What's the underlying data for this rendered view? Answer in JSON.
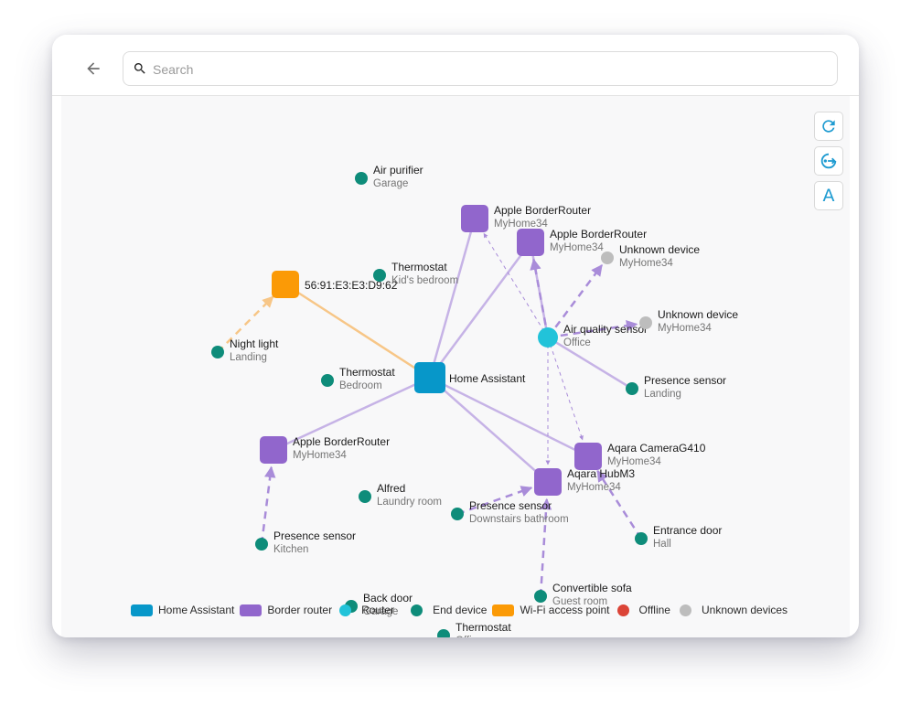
{
  "search": {
    "placeholder": "Search"
  },
  "toolbar": {
    "refresh": "refresh-icon",
    "rotate": "rotate-icon",
    "labels": "A"
  },
  "colors": {
    "home_assistant": "#0797c9",
    "border_router": "#9166cc",
    "router": "#22c3d9",
    "end_device": "#0e8c7a",
    "wifi_ap": "#fb9a06",
    "offline": "#db4437",
    "unknown": "#bdbdbd",
    "edge_solid": "#c6b3e6",
    "edge_dashed": "#a98cd9",
    "edge_wifi": "#f7c687"
  },
  "nodes": [
    {
      "id": "ha",
      "type": "home_assistant",
      "name": "Home Assistant",
      "sub": ""
    },
    {
      "id": "br1",
      "type": "border_router",
      "name": "Apple BorderRouter",
      "sub": "MyHome34"
    },
    {
      "id": "br2",
      "type": "border_router",
      "name": "Apple BorderRouter",
      "sub": "MyHome34"
    },
    {
      "id": "br3",
      "type": "border_router",
      "name": "Apple BorderRouter",
      "sub": "MyHome34"
    },
    {
      "id": "cam",
      "type": "border_router",
      "name": "Aqara CameraG410",
      "sub": "MyHome34"
    },
    {
      "id": "hub",
      "type": "border_router",
      "name": "Aqara HubM3",
      "sub": "MyHome34"
    },
    {
      "id": "wifi",
      "type": "wifi_ap",
      "name": "56:91:E3:E3:D9:62",
      "sub": ""
    },
    {
      "id": "aqs",
      "type": "router",
      "name": "Air quality sensor",
      "sub": "Office"
    },
    {
      "id": "airp",
      "type": "end_device",
      "name": "Air purifier",
      "sub": "Garage"
    },
    {
      "id": "thermo1",
      "type": "end_device",
      "name": "Thermostat",
      "sub": "Kid's bedroom"
    },
    {
      "id": "thermo2",
      "type": "end_device",
      "name": "Thermostat",
      "sub": "Bedroom"
    },
    {
      "id": "thermo3",
      "type": "end_device",
      "name": "Thermostat",
      "sub": "Office"
    },
    {
      "id": "night",
      "type": "end_device",
      "name": "Night light",
      "sub": "Landing"
    },
    {
      "id": "unk1",
      "type": "unknown",
      "name": "Unknown device",
      "sub": "MyHome34"
    },
    {
      "id": "unk2",
      "type": "unknown",
      "name": "Unknown device",
      "sub": "MyHome34"
    },
    {
      "id": "pres1",
      "type": "end_device",
      "name": "Presence sensor",
      "sub": "Landing"
    },
    {
      "id": "pres2",
      "type": "end_device",
      "name": "Presence sensor",
      "sub": "Downstairs bathroom"
    },
    {
      "id": "pres3",
      "type": "end_device",
      "name": "Presence sensor",
      "sub": "Kitchen"
    },
    {
      "id": "alfred",
      "type": "end_device",
      "name": "Alfred",
      "sub": "Laundry room"
    },
    {
      "id": "entr",
      "type": "end_device",
      "name": "Entrance door",
      "sub": "Hall"
    },
    {
      "id": "sofa",
      "type": "end_device",
      "name": "Convertible sofa",
      "sub": "Guest room"
    },
    {
      "id": "backdoor",
      "type": "end_device",
      "name": "Back door",
      "sub": "Garage"
    }
  ],
  "legend": [
    {
      "label": "Home Assistant",
      "color": "#0797c9",
      "shape": "rect"
    },
    {
      "label": "Border router",
      "color": "#9166cc",
      "shape": "rect"
    },
    {
      "label": "Router",
      "color": "#22c3d9",
      "shape": "dot"
    },
    {
      "label": "End device",
      "color": "#0e8c7a",
      "shape": "dot"
    },
    {
      "label": "Wi-Fi access point",
      "color": "#fb9a06",
      "shape": "rect"
    },
    {
      "label": "Offline",
      "color": "#db4437",
      "shape": "dot"
    },
    {
      "label": "Unknown devices",
      "color": "#bdbdbd",
      "shape": "dot"
    }
  ]
}
